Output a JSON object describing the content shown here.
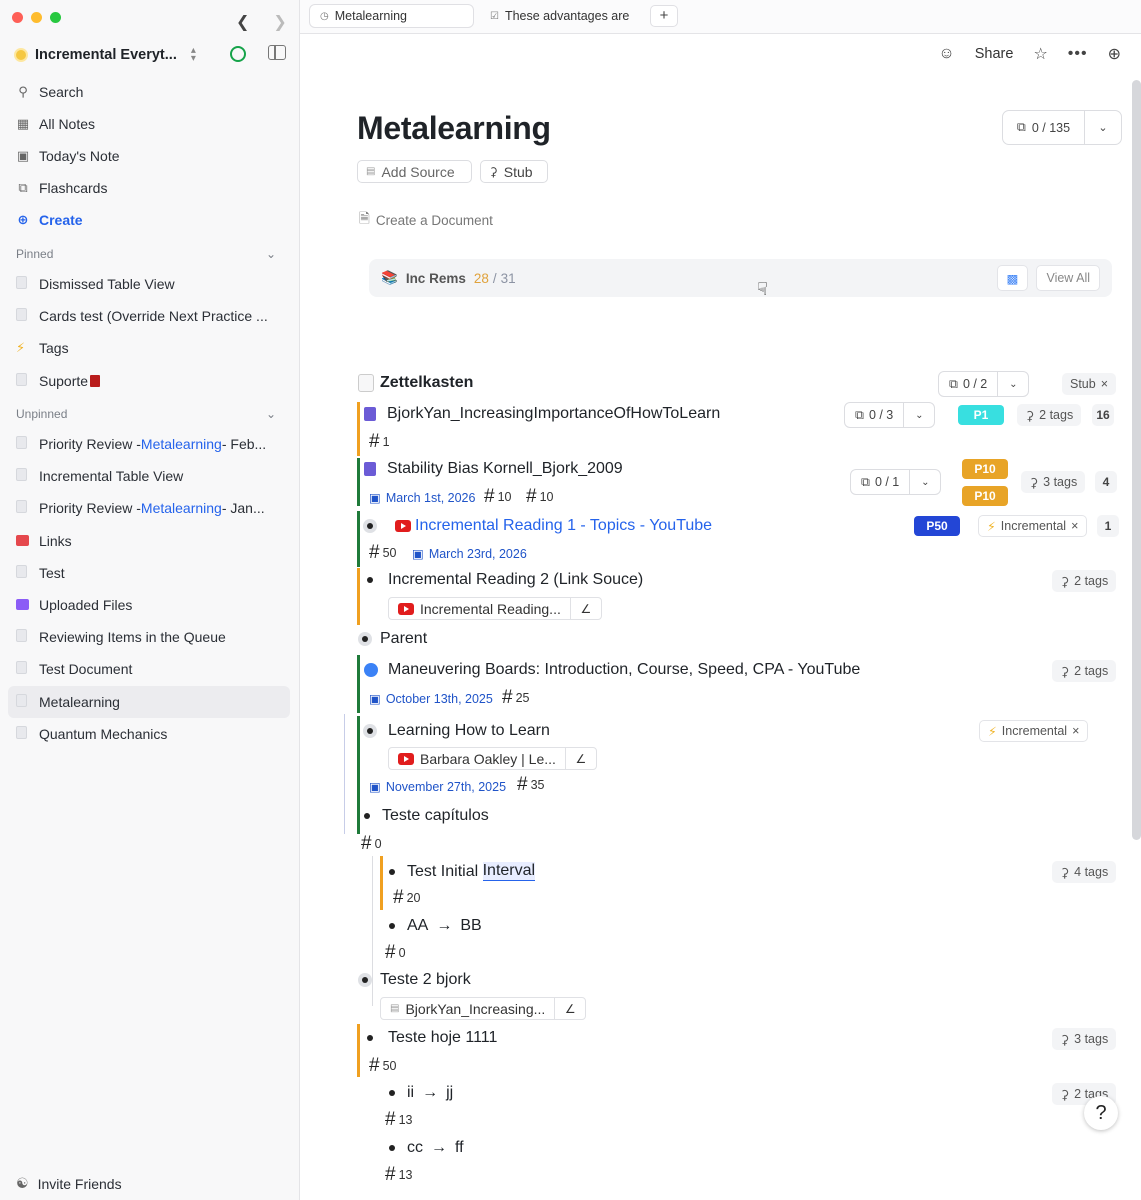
{
  "sidebar": {
    "workspace": "Incremental Everyt...",
    "nav": [
      {
        "label": "Search",
        "icon": "search-icon"
      },
      {
        "label": "All Notes",
        "icon": "grid-icon"
      },
      {
        "label": "Today's Note",
        "icon": "calendar-icon"
      },
      {
        "label": "Flashcards",
        "icon": "cards-icon"
      },
      {
        "label": "Create",
        "icon": "plus-circle-icon"
      }
    ],
    "pinned_label": "Pinned",
    "pinned": [
      "Dismissed Table View",
      "Cards test (Override Next Practice ...",
      "Tags",
      "Suporte"
    ],
    "unpinned_label": "Unpinned",
    "unpinned": [
      {
        "pre": "Priority Review - ",
        "hl": "Metalearning",
        "post": " - Feb..."
      },
      {
        "pre": "Incremental Table View",
        "hl": "",
        "post": ""
      },
      {
        "pre": "Priority Review - ",
        "hl": "Metalearning",
        "post": " - Jan..."
      },
      {
        "pre": "Links",
        "hl": "",
        "post": ""
      },
      {
        "pre": "Test",
        "hl": "",
        "post": ""
      },
      {
        "pre": "Uploaded Files",
        "hl": "",
        "post": ""
      },
      {
        "pre": "Reviewing Items in the Queue",
        "hl": "",
        "post": ""
      },
      {
        "pre": "Test Document",
        "hl": "",
        "post": ""
      },
      {
        "pre": "Metalearning",
        "hl": "",
        "post": ""
      },
      {
        "pre": "Quantum Mechanics",
        "hl": "",
        "post": ""
      }
    ],
    "invite": "Invite Friends"
  },
  "tabs": [
    {
      "label": "Metalearning"
    },
    {
      "label": "These advantages are "
    }
  ],
  "header": {
    "share": "Share"
  },
  "page": {
    "title": "Metalearning",
    "card_count": "0 / 135",
    "add_source": "Add Source",
    "stub": "Stub",
    "create_document": "Create a Document",
    "increms": {
      "label": "Inc Rems",
      "done": "28",
      "sep": "/",
      "total": "31",
      "view_all": "View All"
    }
  },
  "tree": {
    "zettel": {
      "title": "Zettelkasten",
      "count": "0 / 2",
      "tag": "Stub"
    },
    "bjork": {
      "title": "BjorkYan_IncreasingImportanceOfHowToLearn",
      "count": "0 / 3",
      "prio": "P1",
      "tags": "2 tags",
      "num": "16",
      "hash": "1"
    },
    "stability": {
      "title": "Stability Bias Kornell_Bjork_2009",
      "count": "0 / 1",
      "prio1": "P10",
      "prio2": "P10",
      "tags": "3 tags",
      "num": "4",
      "date": "March 1st, 2026",
      "hash1": "10",
      "hash2": "10"
    },
    "ir1": {
      "title": "Incremental Reading 1 - Topics - YouTube",
      "prio": "P50",
      "tag": "Incremental",
      "num": "1",
      "hash": "50",
      "date": "March 23rd, 2026"
    },
    "ir2": {
      "title": "Incremental Reading 2 (Link Souce)",
      "tags": "2 tags",
      "pill": "Incremental Reading..."
    },
    "parent": {
      "title": "Parent"
    },
    "boards": {
      "title": "Maneuvering Boards: Introduction, Course, Speed, CPA - YouTube",
      "tags": "2 tags",
      "date": "October 13th, 2025",
      "hash": "25"
    },
    "learning": {
      "title": "Learning How to Learn",
      "tag": "Incremental",
      "pill": "Barbara Oakley | Le...",
      "date": "November 27th, 2025",
      "hash": "35"
    },
    "teste_cap": {
      "title": "Teste capítulos",
      "hash": "0"
    },
    "tii": {
      "pre": "Test Initial ",
      "hl": "Interval",
      "tags": "4 tags",
      "hash": "20"
    },
    "aa": {
      "a": "AA",
      "b": "BB",
      "hash": "0"
    },
    "teste2": {
      "title": "Teste 2 bjork",
      "pill": "BjorkYan_Increasing..."
    },
    "hoje": {
      "title": "Teste hoje 1111",
      "tags": "3 tags",
      "hash": "50"
    },
    "ii": {
      "a": "ii",
      "b": "jj",
      "tags": "2 tags",
      "hash": "13"
    },
    "cc": {
      "a": "cc",
      "b": "ff",
      "hash": "13"
    }
  },
  "help": "?",
  "colors": {
    "accent": "#2563eb",
    "orange": "#f0a020",
    "green": "#1f7a3a",
    "p1": "#38dfe0",
    "p10": "#e8a427",
    "p50": "#2346d6"
  }
}
